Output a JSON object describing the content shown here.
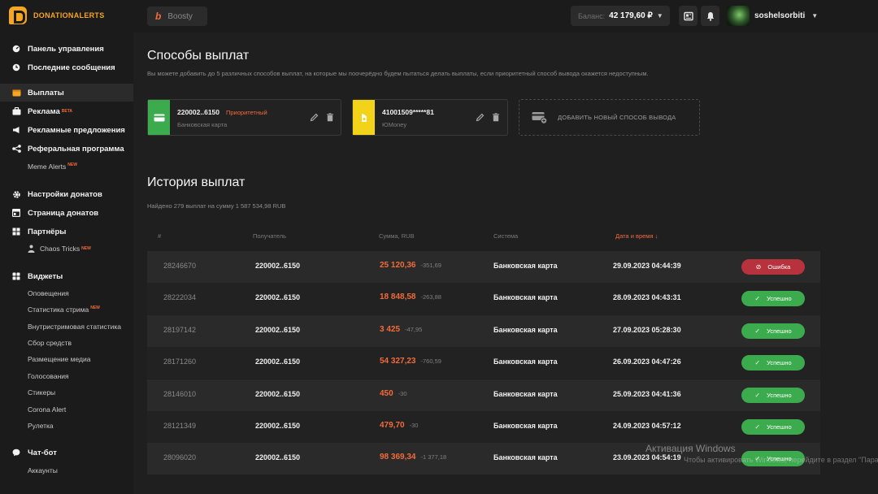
{
  "topbar": {
    "logo_text": "DONATIONALERTS",
    "boosty_label": "Boosty",
    "balance_label": "Баланс:",
    "balance_value": "42 179,60 ₽",
    "username": "soshelsorbiti"
  },
  "sidebar": {
    "dashboard": "Панель управления",
    "last_messages": "Последние сообщения",
    "payouts": "Выплаты",
    "ads": "Реклама",
    "ads_badge": "BETA",
    "ad_offers": "Рекламные предложения",
    "referral": "Реферальная программа",
    "meme_alerts": "Meme Alerts",
    "meme_alerts_badge": "NEW",
    "donation_settings": "Настройки донатов",
    "donation_page": "Страница донатов",
    "partners": "Партнёры",
    "chaos_tricks": "Chaos Tricks",
    "chaos_tricks_badge": "NEW",
    "widgets": "Виджеты",
    "widget_items": [
      "Оповещения",
      "Статистика стрима",
      "Внутристримовая статистика",
      "Сбор средств",
      "Размещение медиа",
      "Голосования",
      "Стикеры",
      "Corona Alert",
      "Рулетка"
    ],
    "stream_stats_badge": "NEW",
    "chatbot": "Чат-бот",
    "accounts": "Аккаунты"
  },
  "payout_methods": {
    "title": "Способы выплат",
    "description": "Вы можете добавить до 5 различных способов выплат, на которые мы поочерёдно будем пытаться делать выплаты, если приоритетный способ вывода окажется недоступным.",
    "cards": [
      {
        "number": "220002..6150",
        "priority_label": "Приоритетный",
        "type": "Банковская карта"
      },
      {
        "number": "41001509*****81",
        "type": "ЮMoney"
      }
    ],
    "add_label": "ДОБАВИТЬ НОВЫЙ СПОСОБ ВЫВОДА"
  },
  "history": {
    "title": "История выплат",
    "summary": "Найдено 279 выплат на сумму 1 587 534,98 RUB",
    "columns": [
      "#",
      "Получатель",
      "Сумма, RUB",
      "Система",
      "Дата и время ↓"
    ],
    "rows": [
      {
        "id": "28246670",
        "recipient": "220002..6150",
        "sum": "25 120,36",
        "fee": "-351,69",
        "system": "Банковская карта",
        "date": "29.09.2023 04:44:39",
        "status": "Ошибка"
      },
      {
        "id": "28222034",
        "recipient": "220002..6150",
        "sum": "18 848,58",
        "fee": "-263,88",
        "system": "Банковская карта",
        "date": "28.09.2023 04:43:31",
        "status": "Успешно"
      },
      {
        "id": "28197142",
        "recipient": "220002..6150",
        "sum": "3 425",
        "fee": "-47,95",
        "system": "Банковская карта",
        "date": "27.09.2023 05:28:30",
        "status": "Успешно"
      },
      {
        "id": "28171260",
        "recipient": "220002..6150",
        "sum": "54 327,23",
        "fee": "-760,59",
        "system": "Банковская карта",
        "date": "26.09.2023 04:47:26",
        "status": "Успешно"
      },
      {
        "id": "28146010",
        "recipient": "220002..6150",
        "sum": "450",
        "fee": "-30",
        "system": "Банковская карта",
        "date": "25.09.2023 04:41:36",
        "status": "Успешно"
      },
      {
        "id": "28121349",
        "recipient": "220002..6150",
        "sum": "479,70",
        "fee": "-30",
        "system": "Банковская карта",
        "date": "24.09.2023 04:57:12",
        "status": "Успешно"
      },
      {
        "id": "28096020",
        "recipient": "220002..6150",
        "sum": "98 369,34",
        "fee": "-1 377,18",
        "system": "Банковская карта",
        "date": "23.09.2023 04:54:19",
        "status": "Успешно"
      }
    ]
  },
  "watermark": {
    "line1": "Активация Windows",
    "line2": "Чтобы активировать Windows, перейдите в раздел \"Параметры\""
  },
  "colors": {
    "accent": "#f26b3a",
    "brand": "#f5a623",
    "success": "#3cab4e",
    "error": "#b8323e",
    "card_green": "#3cab4e",
    "card_yellow": "#f3d31a"
  }
}
